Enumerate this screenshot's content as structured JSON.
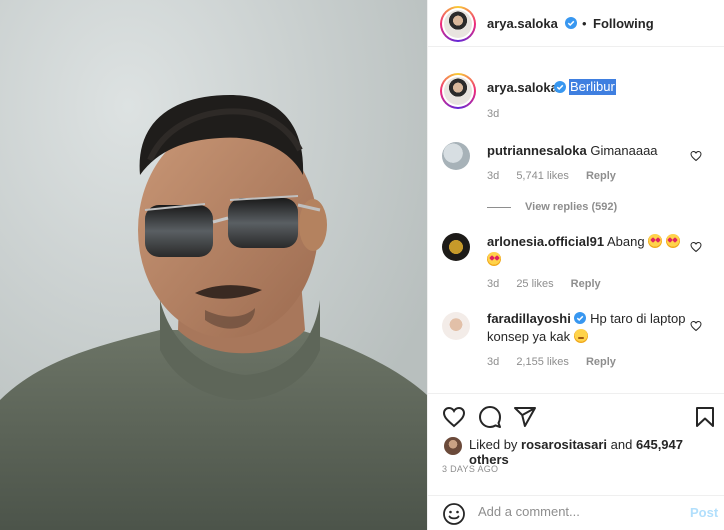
{
  "photo": {
    "alt_subject": "man-selfie-sunglasses-turtleneck"
  },
  "header": {
    "username": "arya.saloka",
    "separator": "•",
    "follow_status": "Following"
  },
  "caption": {
    "username": "arya.saloka",
    "text": "Berlibur",
    "time": "3d"
  },
  "comments": [
    {
      "username": "putriannesaloka",
      "verified": false,
      "text": "Gimanaaaa",
      "time": "3d",
      "likes": "5,741 likes",
      "reply": "Reply",
      "view_replies": "View replies (592)"
    },
    {
      "username": "arlonesia.official91",
      "verified": false,
      "text": "Abang",
      "emojis": [
        "heart-eyes-emoji",
        "heart-eyes-emoji",
        "heart-eyes-emoji"
      ],
      "time": "3d",
      "likes": "25 likes",
      "reply": "Reply"
    },
    {
      "username": "faradillayoshi",
      "verified": true,
      "text": "Hp taro di laptop konsep ya kak",
      "emojis": [
        "thinking-emoji"
      ],
      "time": "3d",
      "likes": "2,155 likes",
      "reply": "Reply"
    }
  ],
  "actions": {
    "icons": [
      "heart-icon",
      "comment-icon",
      "share-icon",
      "bookmark-icon"
    ],
    "liked_by_prefix": "Liked by",
    "liked_by_user": "rosarositasari",
    "liked_by_and": "and",
    "liked_by_others": "645,947 others",
    "time_ago": "3 DAYS AGO"
  },
  "add_comment": {
    "placeholder": "Add a comment...",
    "post_label": "Post"
  },
  "colors": {
    "verified": "#3897f0",
    "secondary_text": "#8e8e8e",
    "post_disabled": "#b2dffc",
    "caption_highlight": "#3f7fe0"
  }
}
